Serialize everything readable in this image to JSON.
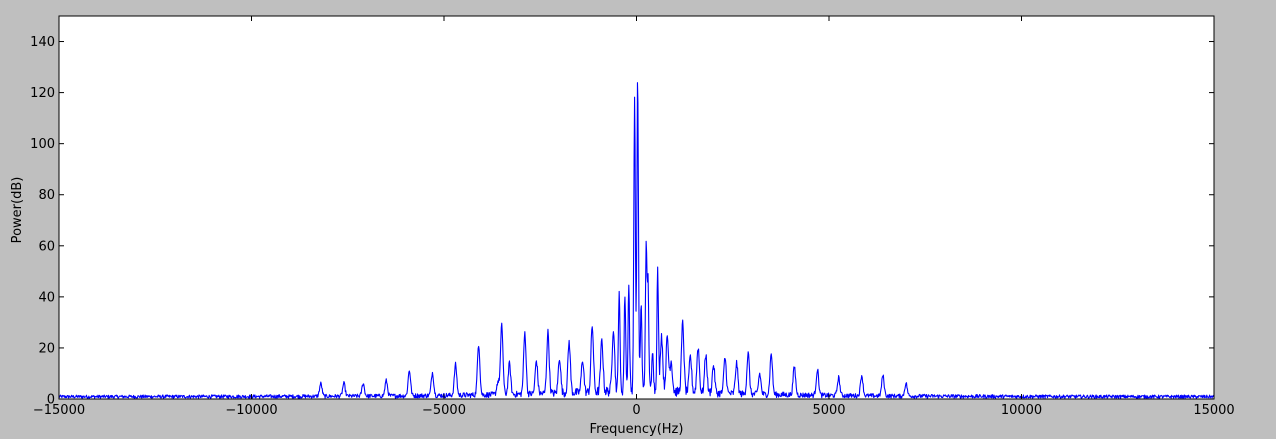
{
  "chart_data": {
    "type": "line",
    "title": "",
    "xlabel": "Frequency(Hz)",
    "ylabel": "Power(dB)",
    "xlim": [
      -15000,
      15000
    ],
    "ylim": [
      0,
      150
    ],
    "xticks": [
      -15000,
      -10000,
      -5000,
      0,
      5000,
      10000,
      15000
    ],
    "xtick_labels": [
      "−15000",
      "−10000",
      "−5000",
      "0",
      "5000",
      "10000",
      "15000"
    ],
    "yticks": [
      0,
      20,
      40,
      60,
      80,
      100,
      120,
      140
    ],
    "ytick_labels": [
      "0",
      "20",
      "40",
      "60",
      "80",
      "100",
      "120",
      "140"
    ],
    "grid": false,
    "legend": "none",
    "colors": {
      "line": "#0000ff",
      "background": "#bfbfbf",
      "plot_area": "#ffffff",
      "axis": "#000000"
    },
    "series": [
      {
        "noise_floor": {
          "edge": 1,
          "center": 4
        },
        "peaks": [
          {
            "x": -8200,
            "y": 5
          },
          {
            "x": -7600,
            "y": 5
          },
          {
            "x": -7100,
            "y": 5
          },
          {
            "x": -6500,
            "y": 6
          },
          {
            "x": -5900,
            "y": 10
          },
          {
            "x": -5300,
            "y": 9
          },
          {
            "x": -4700,
            "y": 12
          },
          {
            "x": -4100,
            "y": 20
          },
          {
            "x": -3600,
            "y": 5
          },
          {
            "x": -3500,
            "y": 27
          },
          {
            "x": -3300,
            "y": 12
          },
          {
            "x": -2900,
            "y": 24
          },
          {
            "x": -2600,
            "y": 13
          },
          {
            "x": -2300,
            "y": 24
          },
          {
            "x": -2000,
            "y": 14
          },
          {
            "x": -1750,
            "y": 20
          },
          {
            "x": -1400,
            "y": 13
          },
          {
            "x": -1150,
            "y": 26
          },
          {
            "x": -900,
            "y": 20
          },
          {
            "x": -600,
            "y": 25
          },
          {
            "x": -450,
            "y": 40
          },
          {
            "x": -300,
            "y": 38
          },
          {
            "x": -200,
            "y": 41
          },
          {
            "x": -50,
            "y": 114
          },
          {
            "x": 30,
            "y": 122
          },
          {
            "x": 120,
            "y": 34
          },
          {
            "x": 250,
            "y": 55
          },
          {
            "x": 300,
            "y": 42
          },
          {
            "x": 420,
            "y": 17
          },
          {
            "x": 550,
            "y": 47
          },
          {
            "x": 650,
            "y": 22
          },
          {
            "x": 800,
            "y": 21
          },
          {
            "x": 900,
            "y": 12
          },
          {
            "x": 1200,
            "y": 27
          },
          {
            "x": 1400,
            "y": 14
          },
          {
            "x": 1600,
            "y": 18
          },
          {
            "x": 1800,
            "y": 15
          },
          {
            "x": 2000,
            "y": 11
          },
          {
            "x": 2300,
            "y": 14
          },
          {
            "x": 2600,
            "y": 12
          },
          {
            "x": 2900,
            "y": 16
          },
          {
            "x": 3200,
            "y": 8
          },
          {
            "x": 3500,
            "y": 16
          },
          {
            "x": 4100,
            "y": 11
          },
          {
            "x": 4700,
            "y": 10
          },
          {
            "x": 5250,
            "y": 7
          },
          {
            "x": 5850,
            "y": 8
          },
          {
            "x": 6400,
            "y": 8
          },
          {
            "x": 7000,
            "y": 5
          }
        ]
      }
    ]
  }
}
